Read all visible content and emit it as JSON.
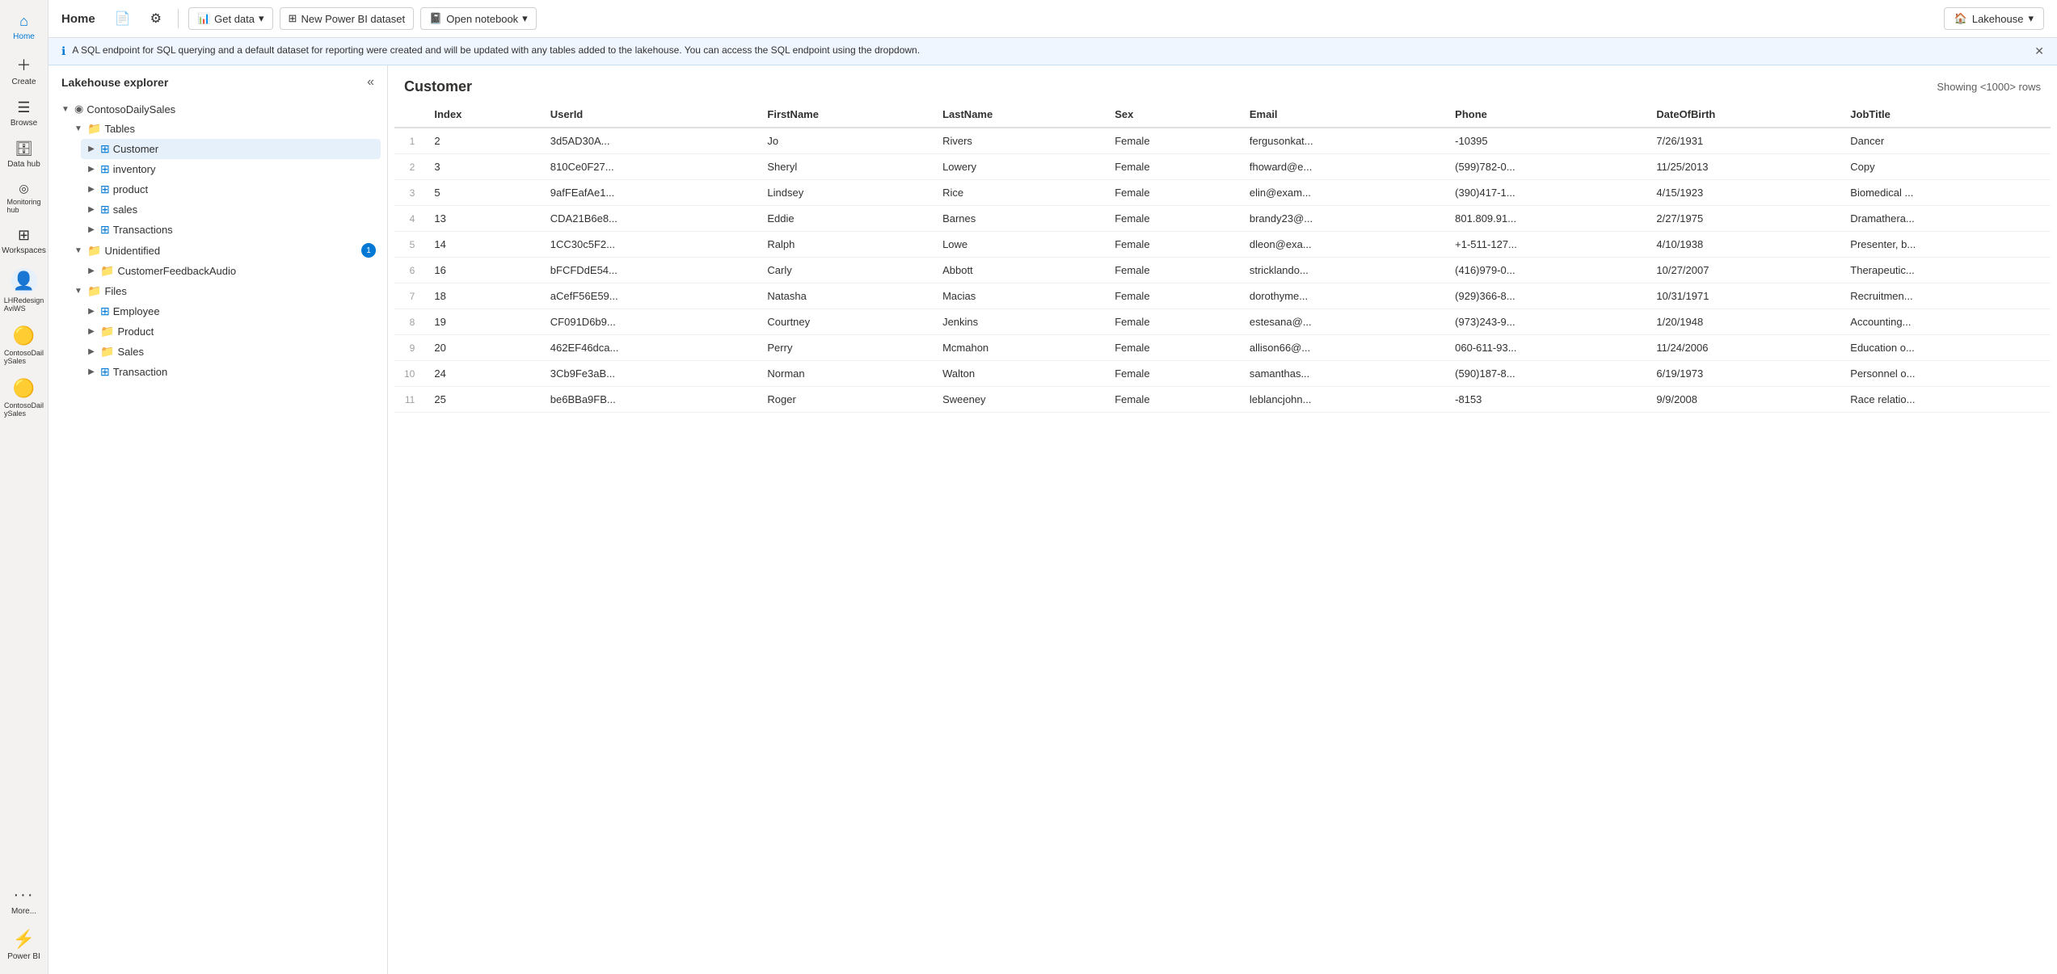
{
  "toolbar": {
    "title": "Home",
    "save_icon": "💾",
    "settings_icon": "⚙",
    "get_data_label": "Get data",
    "new_dataset_label": "New Power BI dataset",
    "open_notebook_label": "Open notebook",
    "lakehouse_label": "Lakehouse",
    "lakehouse_icon": "🏠"
  },
  "info_banner": {
    "text": "A SQL endpoint for SQL querying and a default dataset for reporting were created and will be updated with any tables added to the lakehouse. You can access the SQL endpoint using the dropdown."
  },
  "nav": {
    "items": [
      {
        "id": "home",
        "icon": "⌂",
        "label": "Home"
      },
      {
        "id": "create",
        "icon": "+",
        "label": "Create"
      },
      {
        "id": "browse",
        "icon": "☰",
        "label": "Browse"
      },
      {
        "id": "datahub",
        "icon": "🗄",
        "label": "Data hub"
      },
      {
        "id": "monitoring",
        "icon": "◎",
        "label": "Monitoring hub"
      },
      {
        "id": "workspaces",
        "icon": "⊞",
        "label": "Workspaces"
      },
      {
        "id": "lhredesign",
        "icon": "👤",
        "label": "LHRedesign AviWS"
      },
      {
        "id": "contosodailysales1",
        "icon": "🟡",
        "label": "ContosoDailySales"
      },
      {
        "id": "contosodailysales2",
        "icon": "🟡",
        "label": "ContosoDailySales"
      },
      {
        "id": "more",
        "icon": "···",
        "label": "More..."
      },
      {
        "id": "powerbi",
        "icon": "⚡",
        "label": "Power BI"
      }
    ]
  },
  "explorer": {
    "title": "Lakehouse explorer",
    "workspace": "ContosoDailySales",
    "tables_section": "Tables",
    "tables": [
      {
        "id": "customer",
        "label": "Customer",
        "selected": true
      },
      {
        "id": "inventory",
        "label": "inventory",
        "selected": false
      },
      {
        "id": "product",
        "label": "product",
        "selected": false
      },
      {
        "id": "sales",
        "label": "sales",
        "selected": false
      },
      {
        "id": "transactions",
        "label": "Transactions",
        "selected": false
      }
    ],
    "unidentified_section": "Unidentified",
    "unidentified_badge": "1",
    "unidentified_items": [
      {
        "id": "customerfeedback",
        "label": "CustomerFeedbackAudio"
      }
    ],
    "files_section": "Files",
    "files": [
      {
        "id": "employee",
        "label": "Employee"
      },
      {
        "id": "product",
        "label": "Product"
      },
      {
        "id": "sales",
        "label": "Sales"
      },
      {
        "id": "transaction",
        "label": "Transaction"
      }
    ]
  },
  "table": {
    "title": "Customer",
    "showing": "Showing <1000> rows",
    "columns": [
      "",
      "Index",
      "UserId",
      "FirstName",
      "LastName",
      "Sex",
      "Email",
      "Phone",
      "DateOfBirth",
      "JobTitle"
    ],
    "rows": [
      {
        "rownum": 1,
        "index": 2,
        "userid": "3d5AD30A...",
        "firstname": "Jo",
        "lastname": "Rivers",
        "sex": "Female",
        "email": "fergusonkat...",
        "phone": "-10395",
        "dob": "7/26/1931",
        "job": "Dancer"
      },
      {
        "rownum": 2,
        "index": 3,
        "userid": "810Ce0F27...",
        "firstname": "Sheryl",
        "lastname": "Lowery",
        "sex": "Female",
        "email": "fhoward@e...",
        "phone": "(599)782-0...",
        "dob": "11/25/2013",
        "job": "Copy"
      },
      {
        "rownum": 3,
        "index": 5,
        "userid": "9afFEafAe1...",
        "firstname": "Lindsey",
        "lastname": "Rice",
        "sex": "Female",
        "email": "elin@exam...",
        "phone": "(390)417-1...",
        "dob": "4/15/1923",
        "job": "Biomedical ..."
      },
      {
        "rownum": 4,
        "index": 13,
        "userid": "CDA21B6e8...",
        "firstname": "Eddie",
        "lastname": "Barnes",
        "sex": "Female",
        "email": "brandy23@...",
        "phone": "801.809.91...",
        "dob": "2/27/1975",
        "job": "Dramathera..."
      },
      {
        "rownum": 5,
        "index": 14,
        "userid": "1CC30c5F2...",
        "firstname": "Ralph",
        "lastname": "Lowe",
        "sex": "Female",
        "email": "dleon@exa...",
        "phone": "+1-511-127...",
        "dob": "4/10/1938",
        "job": "Presenter, b..."
      },
      {
        "rownum": 6,
        "index": 16,
        "userid": "bFCFDdE54...",
        "firstname": "Carly",
        "lastname": "Abbott",
        "sex": "Female",
        "email": "stricklando...",
        "phone": "(416)979-0...",
        "dob": "10/27/2007",
        "job": "Therapeutic..."
      },
      {
        "rownum": 7,
        "index": 18,
        "userid": "aCefF56E59...",
        "firstname": "Natasha",
        "lastname": "Macias",
        "sex": "Female",
        "email": "dorothyme...",
        "phone": "(929)366-8...",
        "dob": "10/31/1971",
        "job": "Recruitmen..."
      },
      {
        "rownum": 8,
        "index": 19,
        "userid": "CF091D6b9...",
        "firstname": "Courtney",
        "lastname": "Jenkins",
        "sex": "Female",
        "email": "estesana@...",
        "phone": "(973)243-9...",
        "dob": "1/20/1948",
        "job": "Accounting..."
      },
      {
        "rownum": 9,
        "index": 20,
        "userid": "462EF46dca...",
        "firstname": "Perry",
        "lastname": "Mcmahon",
        "sex": "Female",
        "email": "allison66@...",
        "phone": "060-611-93...",
        "dob": "11/24/2006",
        "job": "Education o..."
      },
      {
        "rownum": 10,
        "index": 24,
        "userid": "3Cb9Fe3aB...",
        "firstname": "Norman",
        "lastname": "Walton",
        "sex": "Female",
        "email": "samanthas...",
        "phone": "(590)187-8...",
        "dob": "6/19/1973",
        "job": "Personnel o..."
      },
      {
        "rownum": 11,
        "index": 25,
        "userid": "be6BBa9FB...",
        "firstname": "Roger",
        "lastname": "Sweeney",
        "sex": "Female",
        "email": "leblancjohn...",
        "phone": "-8153",
        "dob": "9/9/2008",
        "job": "Race relatio..."
      }
    ]
  }
}
